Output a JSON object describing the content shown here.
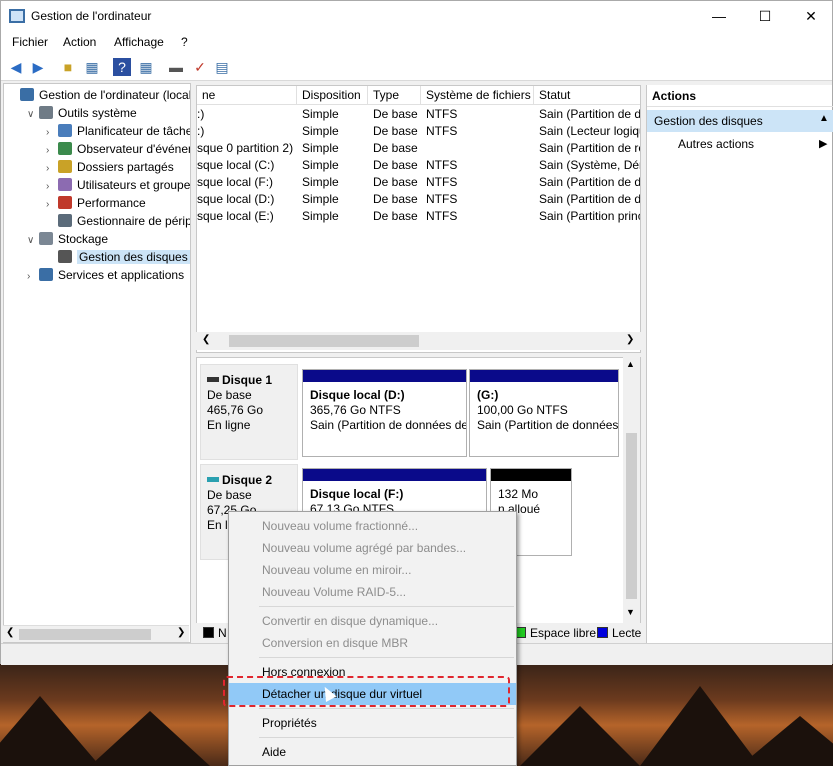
{
  "window": {
    "title": "Gestion de l'ordinateur"
  },
  "menubar": [
    "Fichier",
    "Action",
    "Affichage",
    "?"
  ],
  "toolbar_icons": [
    "back-arrow-icon",
    "forward-arrow-icon",
    "up-folder-icon",
    "show-tree-icon",
    "help-icon",
    "view-icon",
    "disk-icon",
    "check-icon",
    "properties-icon"
  ],
  "tree": [
    {
      "label": "Gestion de l'ordinateur (local)",
      "icon": "computer-icon",
      "level": 0,
      "expander": ""
    },
    {
      "label": "Outils système",
      "icon": "tools-icon",
      "level": 1,
      "expander": "v"
    },
    {
      "label": "Planificateur de tâches",
      "icon": "clock-icon",
      "level": 2,
      "expander": ">"
    },
    {
      "label": "Observateur d'événeme",
      "icon": "event-viewer-icon",
      "level": 2,
      "expander": ">"
    },
    {
      "label": "Dossiers partagés",
      "icon": "shared-folder-icon",
      "level": 2,
      "expander": ">"
    },
    {
      "label": "Utilisateurs et groupes l",
      "icon": "users-icon",
      "level": 2,
      "expander": ">"
    },
    {
      "label": "Performance",
      "icon": "performance-icon",
      "level": 2,
      "expander": ">"
    },
    {
      "label": "Gestionnaire de périphé",
      "icon": "device-manager-icon",
      "level": 2,
      "expander": ""
    },
    {
      "label": "Stockage",
      "icon": "storage-icon",
      "level": 1,
      "expander": "v"
    },
    {
      "label": "Gestion des disques",
      "icon": "disk-management-icon",
      "level": 2,
      "expander": "",
      "selected": true
    },
    {
      "label": "Services et applications",
      "icon": "services-icon",
      "level": 1,
      "expander": ">"
    }
  ],
  "volume_list": {
    "headers": [
      "ne",
      "Disposition",
      "Type",
      "Système de fichiers",
      "Statut"
    ],
    "rows": [
      [
        ":)",
        "Simple",
        "De base",
        "NTFS",
        "Sain (Partition de d"
      ],
      [
        ":)",
        "Simple",
        "De base",
        "NTFS",
        "Sain (Lecteur logiqu"
      ],
      [
        "sque 0 partition 2)",
        "Simple",
        "De base",
        "",
        "Sain (Partition de ré"
      ],
      [
        "sque local  (C:)",
        "Simple",
        "De base",
        "NTFS",
        "Sain (Système, Dém"
      ],
      [
        "sque local  (F:)",
        "Simple",
        "De base",
        "NTFS",
        "Sain (Partition de d"
      ],
      [
        "sque local  (D:)",
        "Simple",
        "De base",
        "NTFS",
        "Sain (Partition de d"
      ],
      [
        "sque local  (E:)",
        "Simple",
        "De base",
        "NTFS",
        "Sain (Partition princ"
      ]
    ]
  },
  "disks": [
    {
      "name": "Disque 1",
      "type": "De base",
      "size": "465,76 Go",
      "status": "En ligne",
      "partitions": [
        {
          "title": "Disque local  (D:)",
          "size": "365,76 Go NTFS",
          "status": "Sain (Partition de données de",
          "bar": "#0a0a8a"
        },
        {
          "title": "(G:)",
          "size": "100,00 Go NTFS",
          "status": "Sain (Partition de données",
          "bar": "#0a0a8a"
        }
      ]
    },
    {
      "name": "Disque 2",
      "type": "De base",
      "size": "67,25 Go",
      "status": "En li",
      "partitions": [
        {
          "title": "Disque local  (F:)",
          "size": "67,13 Go NTFS",
          "status": "",
          "bar": "#0a0a8a"
        },
        {
          "title": "",
          "size": "132 Mo",
          "status": "n alloué",
          "bar": "#000000"
        }
      ]
    }
  ],
  "legend": [
    {
      "label": "N",
      "color": "#000000"
    },
    {
      "label": "Espace libre",
      "color": "#22cc22"
    },
    {
      "label": "Lecte",
      "color": "#0000dd"
    }
  ],
  "actions": {
    "title": "Actions",
    "section": "Gestion des disques",
    "item": "Autres actions"
  },
  "context_menu": [
    {
      "label": "Nouveau volume fractionné...",
      "disabled": true
    },
    {
      "label": "Nouveau volume agrégé par bandes...",
      "disabled": true
    },
    {
      "label": "Nouveau volume en miroir...",
      "disabled": true
    },
    {
      "label": "Nouveau Volume RAID-5...",
      "disabled": true
    },
    {
      "label": "Convertir en disque dynamique...",
      "disabled": true
    },
    {
      "label": "Conversion en disque MBR",
      "disabled": true
    },
    {
      "label": "Hors connexion",
      "disabled": false
    },
    {
      "label": "Détacher un disque dur virtuel",
      "disabled": false,
      "highlighted": true
    },
    {
      "label": "Propriétés",
      "disabled": false
    },
    {
      "label": "Aide",
      "disabled": false
    }
  ],
  "colors": {
    "selection": "#cce4f7",
    "menu_highlight": "#91c9f7",
    "annotation": "#e0262e",
    "primary_partition": "#0a0a8a"
  }
}
